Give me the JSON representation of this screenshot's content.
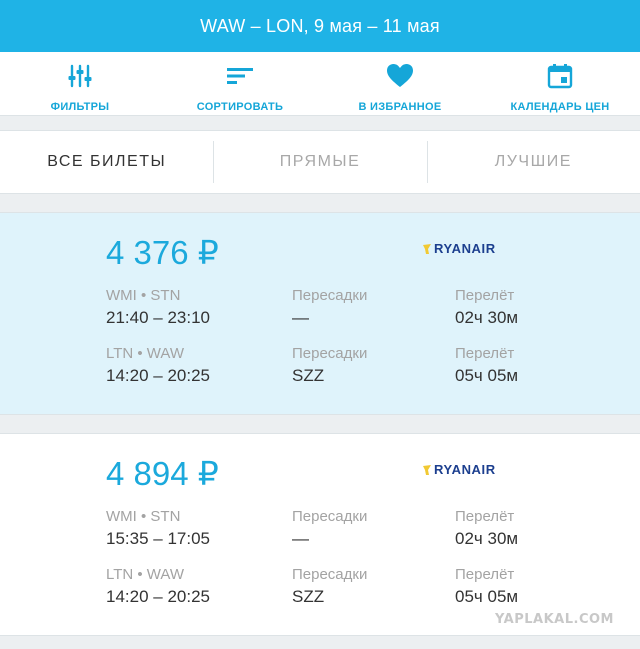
{
  "header": {
    "title": "WAW – LON, 9 мая – 11 мая"
  },
  "toolbar": [
    {
      "label": "ФИЛЬТРЫ",
      "icon": "filter-sliders-icon"
    },
    {
      "label": "СОРТИРОВАТЬ",
      "icon": "sort-lines-icon"
    },
    {
      "label": "В ИЗБРАННОЕ",
      "icon": "heart-icon"
    },
    {
      "label": "КАЛЕНДАРЬ ЦЕН",
      "icon": "calendar-icon"
    }
  ],
  "tabs": [
    {
      "label": "ВСЕ БИЛЕТЫ",
      "active": true
    },
    {
      "label": "ПРЯМЫЕ",
      "active": false
    },
    {
      "label": "ЛУЧШИЕ",
      "active": false
    }
  ],
  "tickets": [
    {
      "price": "4 376 ₽",
      "airline": "RYANAIR",
      "legs": [
        {
          "route": "WMI • STN",
          "time": "21:40 – 23:10",
          "stops_label": "Пересадки",
          "stops": "—",
          "duration_label": "Перелёт",
          "duration": "02ч 30м"
        },
        {
          "route": "LTN • WAW",
          "time": "14:20 – 20:25",
          "stops_label": "Пересадки",
          "stops": "SZZ",
          "duration_label": "Перелёт",
          "duration": "05ч 05м"
        }
      ]
    },
    {
      "price": "4 894 ₽",
      "airline": "RYANAIR",
      "legs": [
        {
          "route": "WMI • STN",
          "time": "15:35 – 17:05",
          "stops_label": "Пересадки",
          "stops": "—",
          "duration_label": "Перелёт",
          "duration": "02ч 30м"
        },
        {
          "route": "LTN • WAW",
          "time": "14:20 – 20:25",
          "stops_label": "Пересадки",
          "stops": "SZZ",
          "duration_label": "Перелёт",
          "duration": "05ч 05м"
        }
      ]
    }
  ],
  "watermark": "YAPLAKAL.COM",
  "colors": {
    "accent": "#1fb3e6",
    "price": "#1ba9dc",
    "selected_bg": "#dff3fb",
    "airline": "#1c3f8f"
  }
}
